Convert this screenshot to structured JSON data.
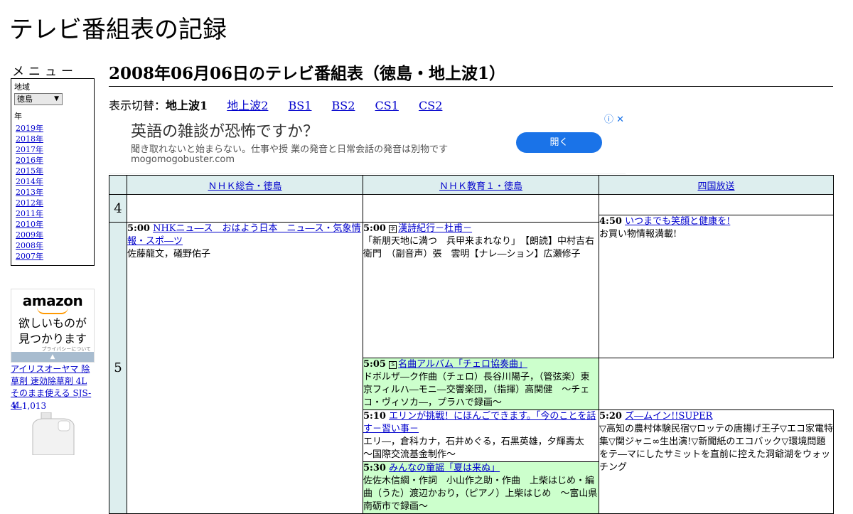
{
  "site_title": "テレビ番組表の記録",
  "sidebar": {
    "menu_heading": "メニュー",
    "region_label": "地域",
    "region_selected": "徳島",
    "year_label": "年",
    "years": [
      "2019年",
      "2018年",
      "2017年",
      "2016年",
      "2015年",
      "2014年",
      "2013年",
      "2012年",
      "2011年",
      "2010年",
      "2009年",
      "2008年",
      "2007年"
    ]
  },
  "ad": {
    "logo": "amazon",
    "tagline_1": "欲しいものが",
    "tagline_2": "見つかります",
    "privacy": "プライバシーについて",
    "product_name": "アイリスオーヤマ 除草剤 速効除草剤 4L そのまま使える SJS-4L",
    "price": "￥ 1,013"
  },
  "page_heading": "2008年06月06日のテレビ番組表（徳島・地上波1）",
  "switch": {
    "label": "表示切替：",
    "current": "地上波1",
    "links": [
      "地上波2",
      "BS1",
      "BS2",
      "CS1",
      "CS2"
    ]
  },
  "banner": {
    "title": "英語の雑談が恐怖ですか？",
    "text": "聞き取れないと始まらない。仕事や授 業の発音と日常会話の発音は別物です",
    "domain": "mogomogobuster.com",
    "button": "開く",
    "icons": "ⓘ ✕"
  },
  "guide": {
    "channels": [
      "ＮＨＫ総合・徳島",
      "ＮＨＫ教育１・徳島",
      "四国放送"
    ],
    "hours": [
      "4",
      "5"
    ],
    "ch1": [
      {
        "time": "5:00",
        "title": "NHKニュ―ス　おはよう日本　ニュ―ス・気象情報・スポ―ツ",
        "desc": "佐藤龍文，礒野佑子"
      }
    ],
    "ch2": [
      {
        "time": "5:00",
        "icon": "字",
        "title": "漢詩紀行－杜甫－",
        "desc": "「新朋天地に満つ　兵甲来まれなり」　【朗読】中村吉右衛門　（副音声）張　雲明【ナレ―ション】広瀬修子"
      },
      {
        "time": "5:05",
        "icon": "Ｓ",
        "title": "名曲アルバム「チェロ協奏曲」",
        "desc": "ドボルザ―ク作曲（チェロ）長谷川陽子，（管弦楽）東京フィルハ―モニ―交響楽団，（指揮）高関健　～チェコ・ヴィソカ―，プラハで録画～"
      },
      {
        "time": "5:10",
        "title": "エリンが挑戦！にほんごできます。「今のことを話す－習い事－",
        "desc": "エリ―，倉科カナ，石井めぐる，石黒英雄，夕輝壽太　～国際交流基金制作～"
      },
      {
        "time": "5:30",
        "title": "みんなの童謡「夏は来ぬ」",
        "desc": "佐佐木信綱・作詞　小山作之助・作曲　上柴はじめ・編曲（うた）渡辺かおり，（ピアノ）上柴はじめ　～富山県南砺市で録画～"
      }
    ],
    "ch3": [
      {
        "time": "4:50",
        "title": "いつまでも笑顔と健康を!",
        "desc": "お買い物情報満載!"
      },
      {
        "time": "5:20",
        "title": "ズ―ムイン!!SUPER",
        "desc": "▽高知の農村体験民宿▽ロッテの唐揚げ王子▽エコ家電特集▽関ジャニ∞生出演!▽新聞紙のエコバック▽環境問題をテ―マにしたサミットを直前に控えた洞爺湖をウォッチング"
      }
    ]
  }
}
